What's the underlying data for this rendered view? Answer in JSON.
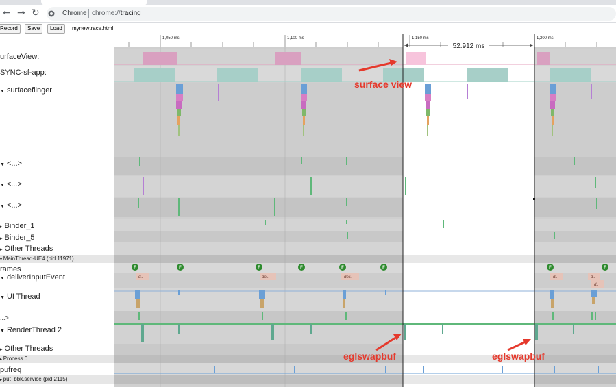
{
  "browser": {
    "back_icon": "arrow-left-icon",
    "forward_icon": "arrow-right-icon",
    "reload_icon": "reload-icon",
    "site_label": "Chrome",
    "url_scheme": "chrome://",
    "url_host": "tracing"
  },
  "toolbar": {
    "record_label": "Record",
    "save_label": "Save",
    "load_label": "Load",
    "filename": "mynewtrace.html"
  },
  "ruler": {
    "ticks": [
      "1,050 ms",
      "1,100 ms",
      "1,150 ms",
      "1,200 ms"
    ],
    "selection_duration": "52.912 ms"
  },
  "tracks": {
    "surfaceview": "urfaceView:",
    "vsync": "SYNC-sf-app:",
    "surfaceflinger": "surfaceflinger",
    "t1": "<...>",
    "t2": "<...>",
    "t3": "<...>",
    "binder1": "Binder_1",
    "binder5": "Binder_5",
    "other1": "Other Threads",
    "mainthread_header": "MainThread-UE4 (pid 11971)",
    "frames": "rames",
    "deliver": "deliverInputEvent",
    "uithread": "UI Thread",
    "dots": "...>",
    "render": "RenderThread 2",
    "other2": "Other Threads",
    "process0": "Process 0",
    "cpufreq": "pufreq",
    "putbbk": "put_bbk.service (pid 2115)"
  },
  "slices": {
    "frame_marker": "F",
    "deliver_short": "d..",
    "deliver_med": "del..",
    "deliver_long": "deli.."
  },
  "annotations": {
    "surface_view": "surface view",
    "egl1": "eglswapbuf",
    "egl2": "eglswapbuf"
  },
  "colors": {
    "annotation": "#e5392c",
    "surfaceview_slice": "#dba4c2",
    "vsync_slice": "#a6d3cd",
    "green_marker": "#2e8b2e",
    "renderthread_line": "#5fb87a"
  }
}
